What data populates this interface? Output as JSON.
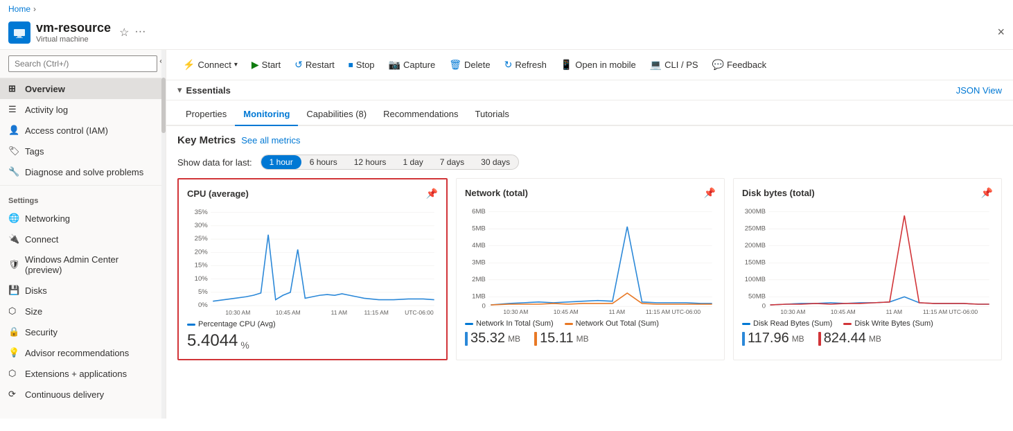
{
  "breadcrumb": {
    "home": "Home",
    "separator": "›"
  },
  "resource": {
    "name": "vm-resource",
    "subtitle": "Virtual machine",
    "close_label": "×"
  },
  "toolbar": {
    "buttons": [
      {
        "id": "connect",
        "label": "Connect",
        "icon": "⚡",
        "has_dropdown": true
      },
      {
        "id": "start",
        "label": "Start",
        "icon": "▶"
      },
      {
        "id": "restart",
        "label": "Restart",
        "icon": "↺"
      },
      {
        "id": "stop",
        "label": "Stop",
        "icon": "□"
      },
      {
        "id": "capture",
        "label": "Capture",
        "icon": "📷"
      },
      {
        "id": "delete",
        "label": "Delete",
        "icon": "🗑"
      },
      {
        "id": "refresh",
        "label": "Refresh",
        "icon": "↻"
      },
      {
        "id": "mobile",
        "label": "Open in mobile",
        "icon": "📱"
      },
      {
        "id": "cli",
        "label": "CLI / PS",
        "icon": "💻"
      },
      {
        "id": "feedback",
        "label": "Feedback",
        "icon": "💬"
      }
    ]
  },
  "essentials": {
    "label": "Essentials",
    "json_view": "JSON View"
  },
  "tabs": [
    {
      "id": "properties",
      "label": "Properties"
    },
    {
      "id": "monitoring",
      "label": "Monitoring",
      "active": true
    },
    {
      "id": "capabilities",
      "label": "Capabilities (8)"
    },
    {
      "id": "recommendations",
      "label": "Recommendations"
    },
    {
      "id": "tutorials",
      "label": "Tutorials"
    }
  ],
  "metrics": {
    "title": "Key Metrics",
    "see_all": "See all metrics",
    "show_data_label": "Show data for last:",
    "time_options": [
      {
        "id": "1h",
        "label": "1 hour",
        "active": true
      },
      {
        "id": "6h",
        "label": "6 hours"
      },
      {
        "id": "12h",
        "label": "12 hours"
      },
      {
        "id": "1d",
        "label": "1 day"
      },
      {
        "id": "7d",
        "label": "7 days"
      },
      {
        "id": "30d",
        "label": "30 days"
      }
    ]
  },
  "charts": {
    "cpu": {
      "title": "CPU (average)",
      "selected": true,
      "legend": "Percentage CPU (Avg)",
      "value": "5.4044",
      "unit": "%",
      "x_labels": [
        "10:30 AM",
        "10:45 AM",
        "11 AM",
        "11:15 AM UTC-06:00"
      ],
      "y_labels": [
        "35%",
        "30%",
        "25%",
        "20%",
        "15%",
        "10%",
        "5%",
        "0%"
      ],
      "color": "#2b88d8"
    },
    "network": {
      "title": "Network (total)",
      "legend_in": "Network In Total (Sum)",
      "legend_out": "Network Out Total (Sum)",
      "value_in": "35.32",
      "unit_in": "MB",
      "value_out": "15.11",
      "unit_out": "MB",
      "x_labels": [
        "10:30 AM",
        "10:45 AM",
        "11 AM",
        "11:15 AM UTC-06:00"
      ],
      "y_labels": [
        "6MB",
        "5MB",
        "4MB",
        "3MB",
        "2MB",
        "1MB",
        "0"
      ],
      "color_in": "#2b88d8",
      "color_out": "#e87825"
    },
    "disk": {
      "title": "Disk bytes (total)",
      "legend_read": "Disk Read Bytes (Sum)",
      "legend_write": "Disk Write Bytes (Sum)",
      "value_read": "117.96",
      "unit_read": "MB",
      "value_write": "824.44",
      "unit_write": "MB",
      "x_labels": [
        "10:30 AM",
        "10:45 AM",
        "11 AM",
        "11:15 AM UTC-06:00"
      ],
      "y_labels": [
        "300MB",
        "250MB",
        "200MB",
        "150MB",
        "100MB",
        "50MB",
        "0"
      ],
      "color_read": "#2b88d8",
      "color_write": "#d13438"
    }
  },
  "sidebar": {
    "search_placeholder": "Search (Ctrl+/)",
    "items_top": [
      {
        "id": "overview",
        "label": "Overview",
        "active": true,
        "icon": "grid"
      },
      {
        "id": "activity-log",
        "label": "Activity log",
        "icon": "list"
      },
      {
        "id": "access-control",
        "label": "Access control (IAM)",
        "icon": "person"
      },
      {
        "id": "tags",
        "label": "Tags",
        "icon": "tag"
      },
      {
        "id": "diagnose",
        "label": "Diagnose and solve problems",
        "icon": "wrench"
      }
    ],
    "settings_label": "Settings",
    "settings_items": [
      {
        "id": "networking",
        "label": "Networking",
        "icon": "network"
      },
      {
        "id": "connect",
        "label": "Connect",
        "icon": "plug"
      },
      {
        "id": "windows-admin",
        "label": "Windows Admin Center (preview)",
        "icon": "shield"
      },
      {
        "id": "disks",
        "label": "Disks",
        "icon": "disk"
      },
      {
        "id": "size",
        "label": "Size",
        "icon": "resize"
      },
      {
        "id": "security",
        "label": "Security",
        "icon": "lock"
      },
      {
        "id": "advisor",
        "label": "Advisor recommendations",
        "icon": "lightbulb"
      },
      {
        "id": "extensions",
        "label": "Extensions + applications",
        "icon": "puzzle"
      },
      {
        "id": "continuous-delivery",
        "label": "Continuous delivery",
        "icon": "delivery"
      }
    ]
  }
}
